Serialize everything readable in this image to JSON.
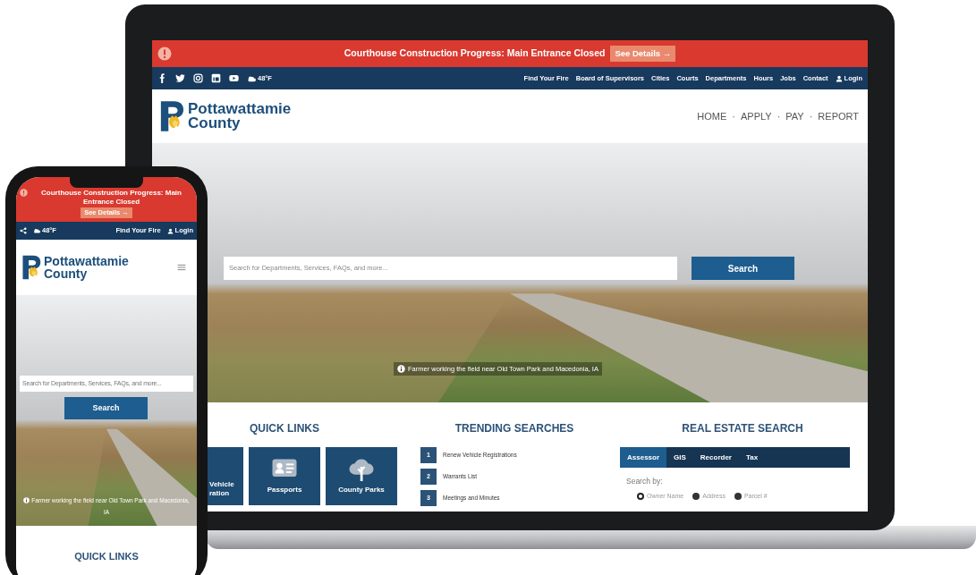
{
  "laptop": {
    "alert": {
      "text": "Courthouse Construction Progress: Main Entrance Closed",
      "button": "See Details →"
    },
    "topbar": {
      "weather": "48°F",
      "links": [
        "Find Your Fire",
        "Board of Supervisors",
        "Cities",
        "Courts",
        "Departments",
        "Hours",
        "Jobs",
        "Contact"
      ],
      "login": "Login"
    },
    "header": {
      "logo_line1": "Pottawattamie",
      "logo_line2": "County",
      "nav": [
        "HOME",
        "APPLY",
        "PAY",
        "REPORT"
      ],
      "nav_separator": "·"
    },
    "hero": {
      "search_placeholder": "Search for Departments, Services, FAQs, and more...",
      "search_button": "Search",
      "caption": "Farmer working the field near Old Town Park and Macedonia, IA"
    },
    "quick_links": {
      "title": "QUICK LINKS",
      "tiles": [
        {
          "kind": "cut",
          "label": "Vehicle ration"
        },
        {
          "kind": "id",
          "label": "Passports"
        },
        {
          "kind": "tree",
          "label": "County Parks"
        }
      ]
    },
    "trending": {
      "title": "TRENDING SEARCHES",
      "items": [
        {
          "number": "1",
          "label": "Renew Vehicle Registrations"
        },
        {
          "number": "2",
          "label": "Warrants List"
        },
        {
          "number": "3",
          "label": "Meetings and Minutes"
        }
      ]
    },
    "real_estate": {
      "title": "REAL ESTATE SEARCH",
      "tabs": [
        {
          "label": "Assessor",
          "selected": true
        },
        {
          "label": "GIS",
          "selected": false
        },
        {
          "label": "Recorder",
          "selected": false
        },
        {
          "label": "Tax",
          "selected": false
        }
      ],
      "search_by": "Search by:",
      "options": [
        {
          "label": "Owner Name",
          "selected": true
        },
        {
          "label": "Address",
          "selected": false
        },
        {
          "label": "Parcel #",
          "selected": false
        }
      ]
    }
  },
  "phone": {
    "alert": {
      "text": "Courthouse Construction Progress: Main Entrance Closed",
      "button": "See Details →"
    },
    "topbar": {
      "weather": "48°F",
      "links": [
        "Find Your Fire"
      ],
      "login": "Login"
    },
    "header": {
      "logo_line1": "Pottawattamie",
      "logo_line2": "County"
    },
    "hero": {
      "search_placeholder": "Search for Departments, Services, FAQs, and more...",
      "search_button": "Search",
      "caption": "Farmer working the field near Old Town Park and Macedonia, IA"
    },
    "quick_links_title": "QUICK LINKS"
  }
}
